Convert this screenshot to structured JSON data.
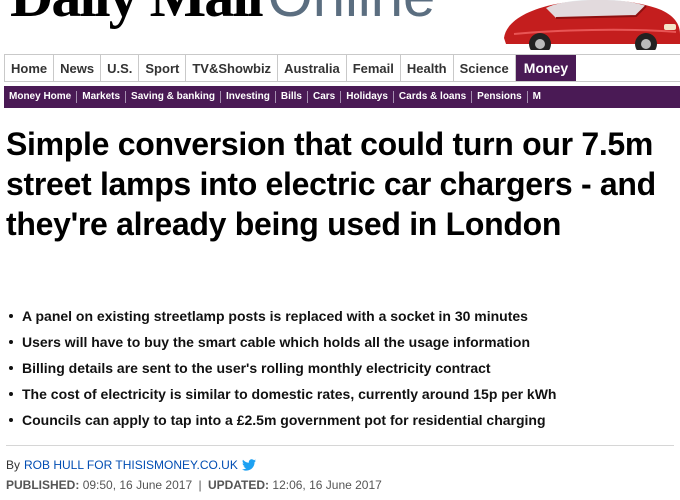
{
  "masthead": {
    "logo_daily": "Daily Mail",
    "logo_online": "Online"
  },
  "nav": {
    "items": [
      {
        "label": "Home"
      },
      {
        "label": "News"
      },
      {
        "label": "U.S."
      },
      {
        "label": "Sport"
      },
      {
        "label": "TV&Showbiz"
      },
      {
        "label": "Australia"
      },
      {
        "label": "Femail"
      },
      {
        "label": "Health"
      },
      {
        "label": "Science"
      },
      {
        "label": "Money"
      }
    ],
    "active": "Money"
  },
  "subnav": {
    "items": [
      {
        "label": "Money Home"
      },
      {
        "label": "Markets"
      },
      {
        "label": "Saving & banking"
      },
      {
        "label": "Investing"
      },
      {
        "label": "Bills"
      },
      {
        "label": "Cars"
      },
      {
        "label": "Holidays"
      },
      {
        "label": "Cards & loans"
      },
      {
        "label": "Pensions"
      },
      {
        "label": "M"
      }
    ]
  },
  "article": {
    "headline": "Simple conversion that could turn our 7.5m street lamps into electric car chargers - and they're already being used in London",
    "bullets": [
      "A panel on existing streetlamp posts is replaced with a socket in 30 minutes",
      "Users will have to buy the smart cable which holds all the usage information",
      "Billing details are sent to the user's rolling monthly electricity contract",
      "The cost of electricity is similar to domestic rates, currently around 15p per kWh",
      "Councils can apply to tap into a £2.5m government pot for residential charging"
    ],
    "byline": {
      "by": "By",
      "author": "ROB HULL FOR THISISMONEY.CO.UK"
    },
    "published_label": "PUBLISHED:",
    "published": "09:50, 16 June 2017",
    "separator": "|",
    "updated_label": "UPDATED:",
    "updated": "12:06, 16 June 2017"
  },
  "colors": {
    "nav_active_bg": "#4a1a55",
    "author_link": "#004db3",
    "twitter": "#1da1f2",
    "car_body": "#c41e1e"
  },
  "icons": {
    "twitter": "twitter-bird-icon",
    "ad": "red-car-advert"
  }
}
